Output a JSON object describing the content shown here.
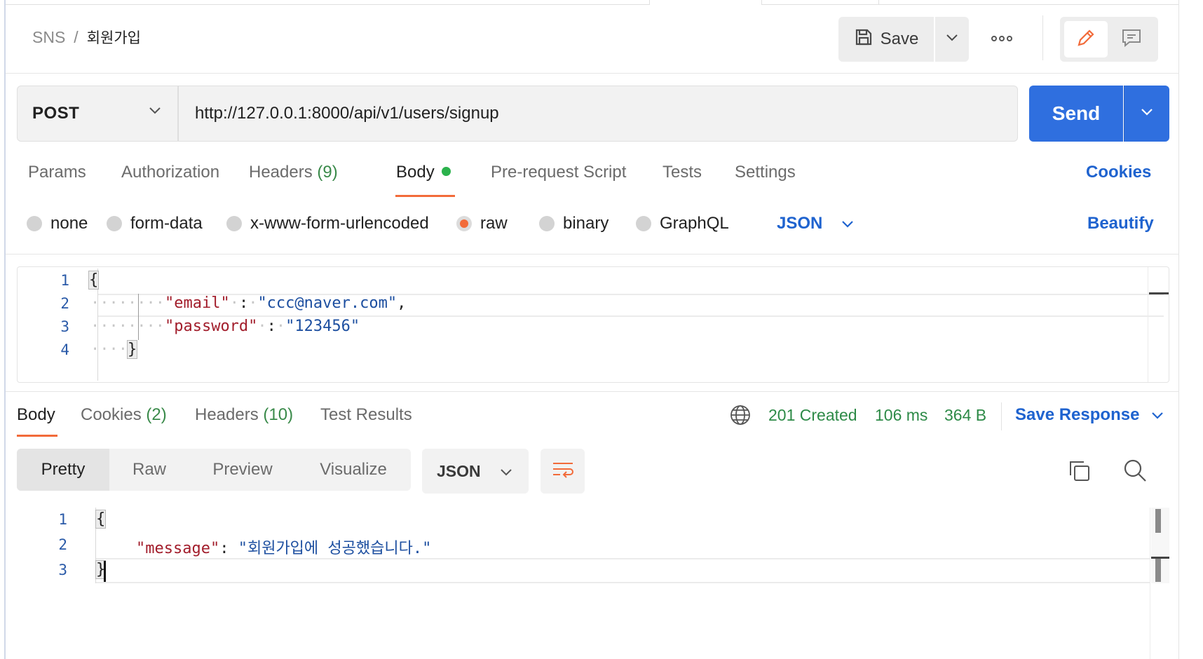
{
  "breadcrumb": {
    "parent": "SNS",
    "separator": "/",
    "current": "회원가입"
  },
  "header": {
    "save_label": "Save"
  },
  "request": {
    "method": "POST",
    "url": "http://127.0.0.1:8000/api/v1/users/signup",
    "send_label": "Send"
  },
  "request_tabs": {
    "params": "Params",
    "authorization": "Authorization",
    "headers": "Headers",
    "headers_count": "(9)",
    "body": "Body",
    "pre_request": "Pre-request Script",
    "tests": "Tests",
    "settings": "Settings",
    "cookies": "Cookies"
  },
  "body_types": {
    "none": "none",
    "form_data": "form-data",
    "urlencoded": "x-www-form-urlencoded",
    "raw": "raw",
    "binary": "binary",
    "graphql": "GraphQL",
    "selected": "raw",
    "language": "JSON",
    "beautify": "Beautify"
  },
  "request_body": {
    "line_numbers": [
      "1",
      "2",
      "3",
      "4"
    ],
    "open_brace": "{",
    "close_brace": "}",
    "fields": [
      {
        "key": "\"email\"",
        "value": "\"ccc@naver.com\"",
        "trailing": ","
      },
      {
        "key": "\"password\"",
        "value": "\"123456\"",
        "trailing": ""
      }
    ]
  },
  "response_tabs": {
    "body": "Body",
    "cookies": "Cookies",
    "cookies_count": "(2)",
    "headers": "Headers",
    "headers_count": "(10)",
    "test_results": "Test Results"
  },
  "response_status": {
    "status": "201 Created",
    "time": "106 ms",
    "size": "364 B",
    "save_response": "Save Response"
  },
  "response_view": {
    "pretty": "Pretty",
    "raw": "Raw",
    "preview": "Preview",
    "visualize": "Visualize",
    "language": "JSON"
  },
  "response_body": {
    "line_numbers": [
      "1",
      "2",
      "3"
    ],
    "open_brace": "{",
    "close_brace": "}",
    "key": "\"message\"",
    "colon": ":",
    "value": "\"회원가입에 성공했습니다.\""
  },
  "colors": {
    "accent": "#f26b3a",
    "primary": "#2f6fdf",
    "success": "#2d8a47",
    "link": "#1f63cf"
  }
}
